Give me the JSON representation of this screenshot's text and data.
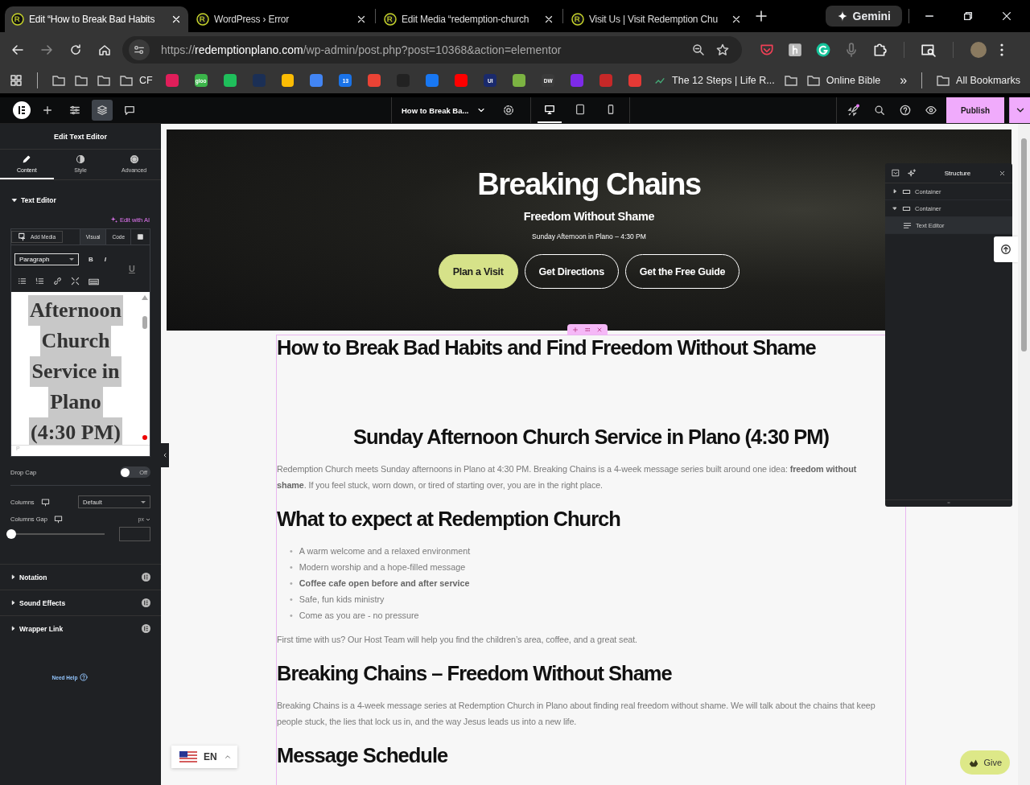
{
  "browser": {
    "tabs": [
      {
        "title": "Edit “How to Break Bad Habits",
        "selected": true
      },
      {
        "title": "WordPress › Error",
        "selected": false
      },
      {
        "title": "Edit Media “redemption-church",
        "selected": false
      },
      {
        "title": "Visit Us | Visit Redemption Chu",
        "selected": false
      }
    ],
    "gemini": "Gemini",
    "url": {
      "scheme": "https://",
      "domain": "redemptionplano.com",
      "path": "/wp-admin/post.php?post=10368&action=elementor"
    },
    "bookmarks": [
      {
        "kind": "folder"
      },
      {
        "kind": "folder"
      },
      {
        "kind": "folder"
      },
      {
        "kind": "folder",
        "label": "CF"
      },
      {
        "kind": "favicon",
        "color": "#e01e5a"
      },
      {
        "kind": "favicon",
        "color": "#3bb54a",
        "glyph": "gloo"
      },
      {
        "kind": "favicon",
        "color": "#1fbf5b"
      },
      {
        "kind": "favicon",
        "color": "#1b2f55"
      },
      {
        "kind": "favicon",
        "color": "#fbbc04"
      },
      {
        "kind": "favicon",
        "color": "#4285f4"
      },
      {
        "kind": "favicon",
        "color": "#1a73e8",
        "glyph": "13"
      },
      {
        "kind": "favicon",
        "color": "#ea4335"
      },
      {
        "kind": "favicon",
        "color": "#222222"
      },
      {
        "kind": "favicon",
        "color": "#1877f2"
      },
      {
        "kind": "favicon",
        "color": "#ff0000"
      },
      {
        "kind": "favicon",
        "color": "#1a2a6c",
        "glyph": "UI"
      },
      {
        "kind": "favicon",
        "color": "#7cb342"
      },
      {
        "kind": "favicon",
        "color": "#3a3a3a",
        "glyph": "DW"
      },
      {
        "kind": "favicon",
        "color": "#7d2ae8"
      },
      {
        "kind": "favicon",
        "color": "#c62828"
      },
      {
        "kind": "favicon",
        "color": "#e53935"
      },
      {
        "kind": "link",
        "label": "The 12 Steps | Life R..."
      },
      {
        "kind": "folder"
      },
      {
        "kind": "folder",
        "label": "Online Bible"
      }
    ],
    "more": "»",
    "all_bookmarks": "All Bookmarks"
  },
  "editor_bar": {
    "document_title": "How to Break Ba...",
    "devices": [
      {
        "kind": "desktop",
        "selected": true
      },
      {
        "kind": "tablet",
        "selected": false
      },
      {
        "kind": "mobile",
        "selected": false
      }
    ],
    "publish": "Publish"
  },
  "panel": {
    "title": "Edit Text Editor",
    "tabs": [
      {
        "label": "Content",
        "kind": "pencil",
        "selected": true
      },
      {
        "label": "Style",
        "kind": "contrast",
        "selected": false
      },
      {
        "label": "Advanced",
        "kind": "gear",
        "selected": false
      }
    ],
    "section": {
      "label": "Text Editor",
      "expanded": true
    },
    "edit_with_ai": "Edit with AI",
    "add_media": "Add Media",
    "modes": [
      {
        "label": "Visual",
        "selected": true
      },
      {
        "label": "Code",
        "selected": false
      }
    ],
    "format": "Paragraph",
    "format_buttons": [
      "B",
      "I",
      "U"
    ],
    "editor_lines": [
      "Afternoon",
      "Church",
      "Service in",
      "Plano",
      "(4:30 PM)"
    ],
    "editor_status": "P",
    "drop_cap": {
      "label": "Drop Cap",
      "on": false,
      "state_label": "Off"
    },
    "columns": {
      "label": "Columns",
      "value": "Default"
    },
    "columns_gap": {
      "label": "Columns Gap",
      "unit": "px",
      "level": 0
    },
    "sections": [
      {
        "label": "Notation",
        "expanded": false
      },
      {
        "label": "Sound Effects",
        "expanded": false
      },
      {
        "label": "Wrapper Link",
        "expanded": false
      }
    ],
    "help": "Need Help"
  },
  "hero": {
    "title": "Breaking Chains",
    "subtitle": "Freedom Without Shame",
    "info": "Sunday Afternoon in Plano – 4:30 PM",
    "buttons": [
      {
        "label": "Plan a Visit",
        "kind": "primary"
      },
      {
        "label": "Get Directions",
        "kind": "outline"
      },
      {
        "label": "Get the Free Guide",
        "kind": "outline"
      }
    ]
  },
  "content": [
    {
      "kind": "h1",
      "text": "How to Break Bad Habits and Find Freedom Without Shame"
    },
    {
      "kind": "h2c",
      "text": "Sunday Afternoon Church Service in Plano (4:30 PM)"
    },
    {
      "kind": "p",
      "text": "Redemption Church meets Sunday afternoons in Plano at 4:30 PM. Breaking Chains is a 4-week message series built around one idea: **freedom without shame**. If you feel stuck, worn down, or tired of starting over, you are in the right place."
    },
    {
      "kind": "h2",
      "text": "What to expect at Redemption Church"
    },
    {
      "kind": "list",
      "marker": "•",
      "items": [
        {
          "text": "A warm welcome and a relaxed environment",
          "bold": false
        },
        {
          "text": "Modern worship and a hope-filled message",
          "bold": false
        },
        {
          "text": "Coffee cafe open before and after service",
          "bold": true
        },
        {
          "text": "Safe, fun kids ministry",
          "bold": false
        },
        {
          "text": "Come as you are - no pressure",
          "bold": false
        }
      ]
    },
    {
      "kind": "p",
      "text": "First time with us? Our Host Team will help you find the children’s area, coffee, and a great seat."
    },
    {
      "kind": "h2",
      "text": "Breaking Chains – Freedom Without Shame"
    },
    {
      "kind": "p",
      "text": "Breaking Chains is a 4-week message series at Redemption Church in Plano about finding real freedom without shame. We will talk about the chains that keep people stuck, the lies that lock us in, and the way Jesus leads us into a new life."
    },
    {
      "kind": "h2",
      "text": "Message Schedule"
    }
  ],
  "structure": {
    "title": "Structure",
    "tree": [
      {
        "label": "Container",
        "expanded": false,
        "selected": false
      },
      {
        "label": "Container",
        "expanded": true,
        "selected": false,
        "children": [
          {
            "label": "Text Editor",
            "selected": true
          }
        ]
      }
    ]
  },
  "language": "EN",
  "give": "Give"
}
